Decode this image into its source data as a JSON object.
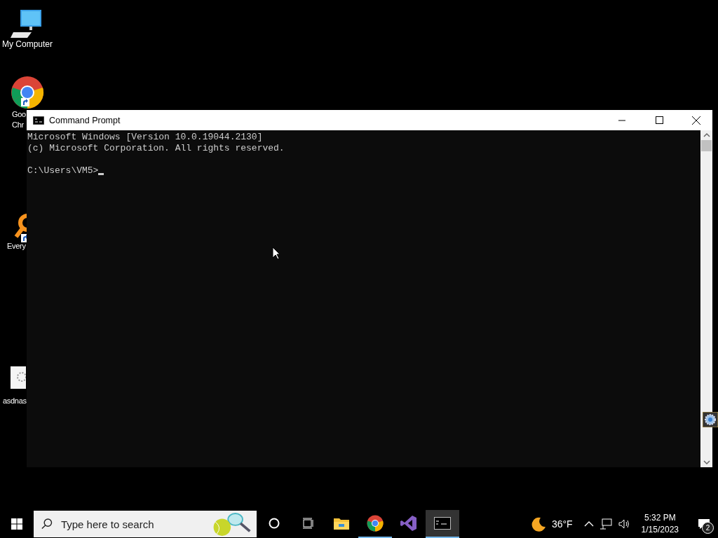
{
  "desktop_icons": [
    {
      "kind": "computer",
      "label_lines": [
        "My Computer"
      ],
      "shortcut": false
    },
    {
      "kind": "browser",
      "label_lines": [
        "Goo",
        "Chr"
      ],
      "shortcut": true
    },
    {
      "kind": "search",
      "label_lines": [
        "Every"
      ],
      "shortcut": true
    },
    {
      "kind": "file",
      "label_lines": [
        "asdnas"
      ],
      "shortcut": false
    }
  ],
  "window": {
    "title": "Command Prompt",
    "output": [
      "Microsoft Windows [Version 10.0.19044.2130]",
      "(c) Microsoft Corporation. All rights reserved."
    ],
    "prompt": "C:\\Users\\VM5>"
  },
  "taskbar": {
    "search": {
      "placeholder": "Type here to search"
    },
    "apps": [
      {
        "kind": "folder",
        "running": false,
        "selected": false
      },
      {
        "kind": "browser",
        "running": true,
        "selected": false
      },
      {
        "kind": "studio",
        "running": false,
        "selected": false
      },
      {
        "kind": "terminal",
        "running": true,
        "selected": true
      }
    ],
    "weather": "36°F",
    "time": "5:32 PM",
    "date": "1/15/2023",
    "notifications": "2"
  }
}
